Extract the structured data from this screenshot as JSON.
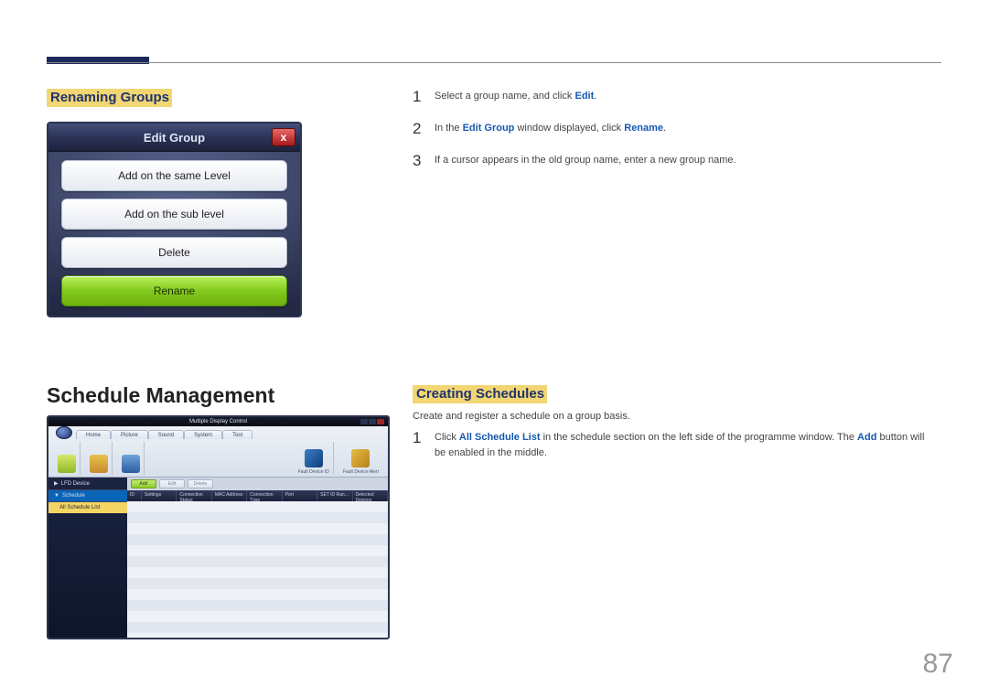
{
  "page_number": "87",
  "headings": {
    "renaming_groups": "Renaming Groups",
    "schedule_management": "Schedule Management",
    "creating_schedules": "Creating Schedules"
  },
  "edit_group_dialog": {
    "title": "Edit Group",
    "close_glyph": "x",
    "buttons": {
      "same_level": "Add on the same Level",
      "sub_level": "Add on the sub level",
      "delete": "Delete",
      "rename": "Rename"
    }
  },
  "sched_window": {
    "title": "Multiple Display Control",
    "tabs": {
      "home": "Home",
      "picture": "Picture",
      "sound": "Sound",
      "system": "System",
      "tool": "Tool"
    },
    "ribbon_groups": {
      "fault_id": "Fault Device ID",
      "fault_alert": "Fault Device Alert"
    },
    "sidebar": {
      "lfd": "LFD Device",
      "schedule": "Schedule",
      "all_list": "All Schedule List"
    },
    "toolbar": {
      "add": "Add",
      "edit": "Edit",
      "delete": "Delete"
    },
    "columns": {
      "id": "ID",
      "settings": "Settings",
      "conn_status": "Connection Status",
      "mac": "MAC Address",
      "conn_type": "Connection Type",
      "port": "Port",
      "setid": "SET ID Ran...",
      "detected": "Detected Devices"
    }
  },
  "rename_steps": {
    "s1_a": "Select a group name, and click ",
    "s1_b": "Edit",
    "s1_c": ".",
    "s2_a": "In the ",
    "s2_b": "Edit Group",
    "s2_c": " window displayed, click ",
    "s2_d": "Rename",
    "s2_e": ".",
    "s3": "If a cursor appears in the old group name, enter a new group name."
  },
  "create_steps": {
    "intro": "Create and register a schedule on a group basis.",
    "s1_a": "Click ",
    "s1_b": "All Schedule List",
    "s1_c": " in the schedule section on the left side of the programme window. The ",
    "s1_d": "Add",
    "s1_e": " button will be enabled in the middle."
  }
}
